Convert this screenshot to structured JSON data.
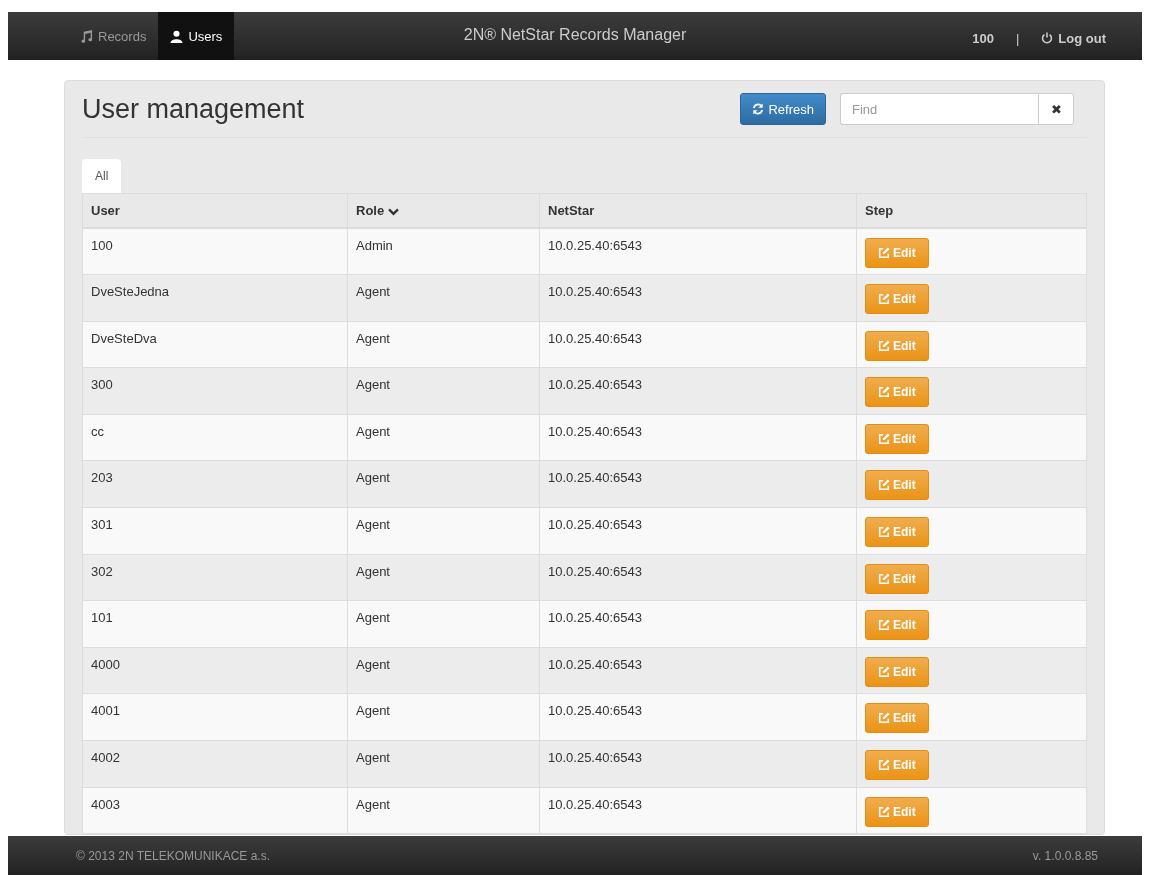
{
  "navbar": {
    "tabs": [
      {
        "label": "Records",
        "selected": false
      },
      {
        "label": "Users",
        "selected": true
      }
    ],
    "title": "2N® NetStar Records Manager",
    "user": "100",
    "separator": "|",
    "logout": "Log out"
  },
  "page": {
    "heading": "User management",
    "refresh": "Refresh",
    "search": {
      "placeholder": "Find"
    },
    "clear": "✖"
  },
  "filter_tabs": [
    {
      "label": "All",
      "selected": true
    }
  ],
  "table": {
    "columns": [
      {
        "label": "User",
        "sorted": false
      },
      {
        "label": "Role",
        "sorted": true
      },
      {
        "label": "NetStar",
        "sorted": false
      },
      {
        "label": "Step",
        "sorted": false
      }
    ],
    "rows": [
      {
        "user": "100",
        "role": "Admin",
        "netstar": "10.0.25.40:6543",
        "action": "Edit"
      },
      {
        "user": "DveSteJedna",
        "role": "Agent",
        "netstar": "10.0.25.40:6543",
        "action": "Edit"
      },
      {
        "user": "DveSteDva",
        "role": "Agent",
        "netstar": "10.0.25.40:6543",
        "action": "Edit"
      },
      {
        "user": "300",
        "role": "Agent",
        "netstar": "10.0.25.40:6543",
        "action": "Edit"
      },
      {
        "user": "cc",
        "role": "Agent",
        "netstar": "10.0.25.40:6543",
        "action": "Edit"
      },
      {
        "user": "203",
        "role": "Agent",
        "netstar": "10.0.25.40:6543",
        "action": "Edit"
      },
      {
        "user": "301",
        "role": "Agent",
        "netstar": "10.0.25.40:6543",
        "action": "Edit"
      },
      {
        "user": "302",
        "role": "Agent",
        "netstar": "10.0.25.40:6543",
        "action": "Edit"
      },
      {
        "user": "101",
        "role": "Agent",
        "netstar": "10.0.25.40:6543",
        "action": "Edit"
      },
      {
        "user": "4000",
        "role": "Agent",
        "netstar": "10.0.25.40:6543",
        "action": "Edit"
      },
      {
        "user": "4001",
        "role": "Agent",
        "netstar": "10.0.25.40:6543",
        "action": "Edit"
      },
      {
        "user": "4002",
        "role": "Agent",
        "netstar": "10.0.25.40:6543",
        "action": "Edit"
      },
      {
        "user": "4003",
        "role": "Agent",
        "netstar": "10.0.25.40:6543",
        "action": "Edit"
      }
    ]
  },
  "footer": {
    "copyright": "© 2013 2N TELEKOMUNIKACE a.s.",
    "version": "v. 1.0.0.8.85"
  }
}
